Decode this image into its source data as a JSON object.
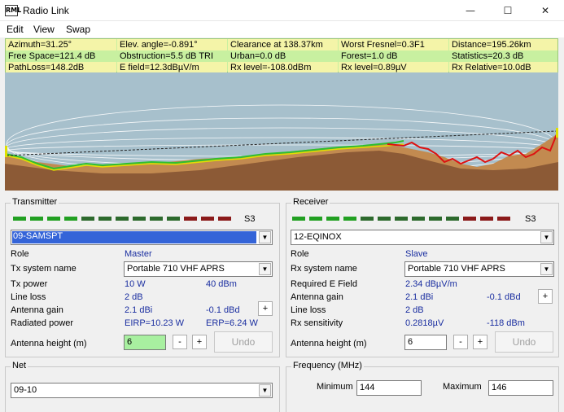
{
  "window": {
    "title": "Radio Link",
    "icon_label": "RML"
  },
  "window_controls": {
    "minimize": "—",
    "maximize": "☐",
    "close": "✕"
  },
  "menu": {
    "edit": "Edit",
    "view": "View",
    "swap": "Swap"
  },
  "info": {
    "row1": [
      "Azimuth=31.25°",
      "Elev. angle=-0.891°",
      "Clearance at 138.37km",
      "Worst Fresnel=0.3F1",
      "Distance=195.26km"
    ],
    "row2": [
      "Free Space=121.4 dB",
      "Obstruction=5.5 dB TRI",
      "Urban=0.0 dB",
      "Forest=1.0 dB",
      "Statistics=20.3 dB"
    ],
    "row3": [
      "PathLoss=148.2dB",
      "E field=12.3dBµV/m",
      "Rx level=-108.0dBm",
      "Rx level=0.89µV",
      "Rx Relative=10.0dB"
    ]
  },
  "colors": {
    "meter_green": "#22a022",
    "meter_dark_green": "#2d6a2d",
    "meter_red": "#8b1a1a",
    "selected_bg": "#3464d8",
    "label_blue": "#1a2ea0"
  },
  "transmitter": {
    "title": "Transmitter",
    "meter_label": "S3",
    "meter_segments": [
      "green",
      "green",
      "green",
      "green",
      "dkgreen",
      "dkgreen",
      "dkgreen",
      "dkgreen",
      "dkgreen",
      "dkgreen",
      "red",
      "red",
      "red"
    ],
    "unit": "09-SAMSPT",
    "role_label": "Role",
    "role_value": "Master",
    "system_label": "Tx system name",
    "system_value": "Portable 710 VHF APRS",
    "power_label": "Tx power",
    "power_w": "10 W",
    "power_dbm": "40 dBm",
    "line_loss_label": "Line loss",
    "line_loss_value": "2 dB",
    "gain_label": "Antenna gain",
    "gain_dbi": "2.1 dBi",
    "gain_dbd": "-0.1 dBd",
    "radiated_label": "Radiated power",
    "eirp": "EIRP=10.23 W",
    "erp": "ERP=6.24 W",
    "height_label": "Antenna height (m)",
    "height_value": "6",
    "minus": "-",
    "plus": "+",
    "undo": "Undo"
  },
  "receiver": {
    "title": "Receiver",
    "meter_label": "S3",
    "meter_segments": [
      "green",
      "green",
      "green",
      "green",
      "dkgreen",
      "dkgreen",
      "dkgreen",
      "dkgreen",
      "dkgreen",
      "dkgreen",
      "red",
      "red",
      "red"
    ],
    "unit": "12-EQINOX",
    "role_label": "Role",
    "role_value": "Slave",
    "system_label": "Rx system name",
    "system_value": "Portable 710 VHF APRS",
    "field_label": "Required E Field",
    "field_value": "2.34 dBµV/m",
    "gain_label": "Antenna gain",
    "gain_dbi": "2.1 dBi",
    "gain_dbd": "-0.1 dBd",
    "line_loss_label": "Line loss",
    "line_loss_value": "2 dB",
    "sens_label": "Rx sensitivity",
    "sens_uv": "0.2818µV",
    "sens_dbm": "-118 dBm",
    "height_label": "Antenna height (m)",
    "height_value": "6",
    "minus": "-",
    "plus": "+",
    "undo": "Undo"
  },
  "net": {
    "title": "Net",
    "value": "09-10"
  },
  "frequency": {
    "title": "Frequency (MHz)",
    "min_label": "Minimum",
    "min_value": "144",
    "max_label": "Maximum",
    "max_value": "146"
  }
}
